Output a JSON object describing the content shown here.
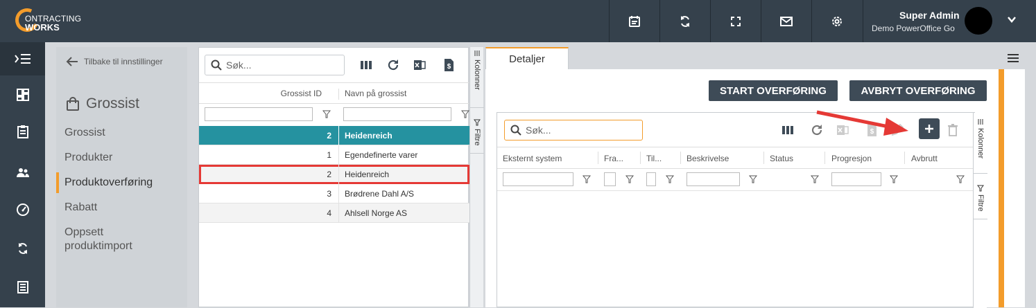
{
  "brand": {
    "line1": "ONTRACTING",
    "line2": "WORKS",
    "accent": "#f39c2b"
  },
  "topbar": {
    "icons": [
      "calendar-icon",
      "sync-icon",
      "fullscreen-icon",
      "mail-icon",
      "gear-icon"
    ],
    "user_name": "Super Admin",
    "user_org": "Demo PowerOffice Go"
  },
  "leftnav": [
    "menu-toggle-icon",
    "dashboard-icon",
    "clipboard-icon",
    "users-icon",
    "gauge-icon",
    "sync-icon",
    "list-icon"
  ],
  "settings": {
    "back_label": "Tilbake til innstillinger",
    "section_title": "Grossist",
    "items": [
      "Grossist",
      "Produkter",
      "Produktoverføring",
      "Rabatt",
      "Oppsett produktimport"
    ],
    "active_index": 2
  },
  "list": {
    "search_placeholder": "Søk...",
    "col_id": "Grossist ID",
    "col_name": "Navn på grossist",
    "rows": [
      {
        "id": "2",
        "name": "Heidenreich",
        "selected": true
      },
      {
        "id": "1",
        "name": "Egendefinerte varer"
      },
      {
        "id": "2",
        "name": "Heidenreich",
        "highlighted": true
      },
      {
        "id": "3",
        "name": "Brødrene Dahl A/S"
      },
      {
        "id": "4",
        "name": "Ahlsell Norge AS"
      }
    ],
    "side_tabs": [
      "Kolonner",
      "Filtre"
    ]
  },
  "detail": {
    "tab_label": "Detaljer",
    "start_button": "START OVERFØRING",
    "cancel_button": "AVBRYT OVERFØRING",
    "search_placeholder": "Søk...",
    "columns": [
      "Eksternt system",
      "Fra...",
      "Til...",
      "Beskrivelse",
      "Status",
      "Progresjon",
      "Avbrutt"
    ],
    "side_tabs": [
      "Kolonner",
      "Filtre"
    ]
  }
}
